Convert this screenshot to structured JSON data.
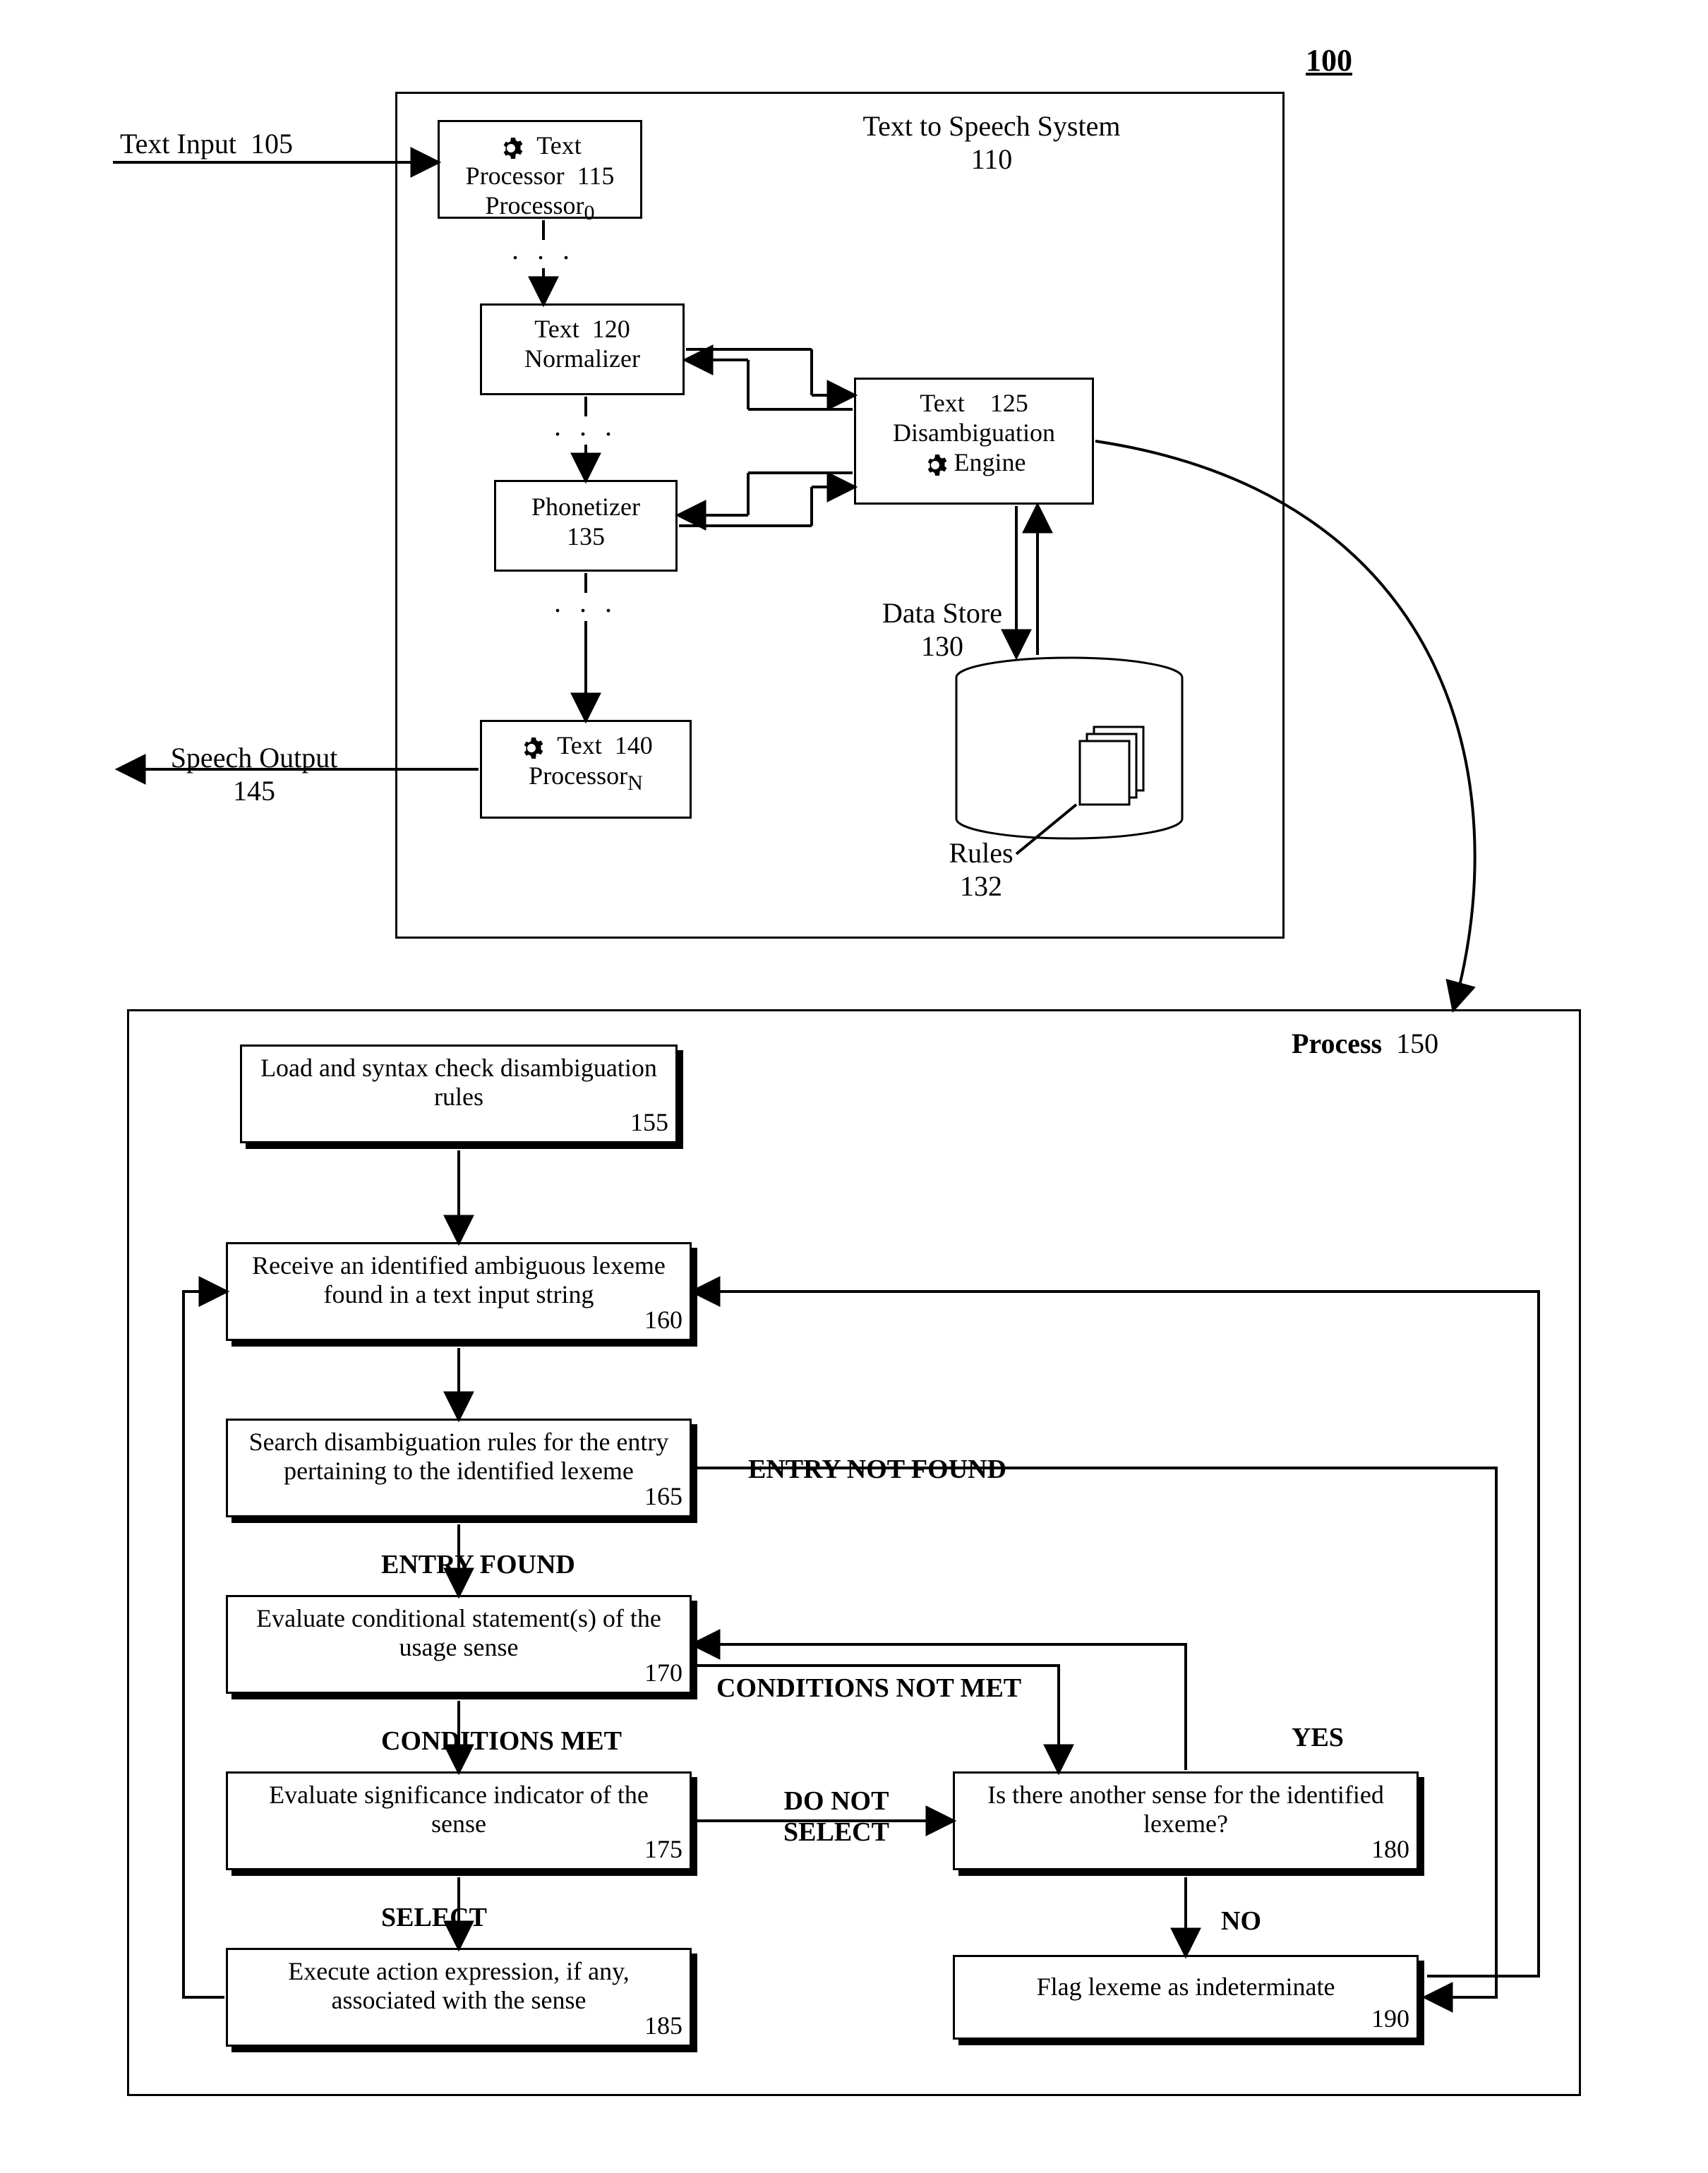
{
  "fig_ref": "100",
  "text_input_label": "Text Input",
  "text_input_ref": "105",
  "speech_output_label": "Speech Output",
  "speech_output_ref": "145",
  "sys_panel_label": "Text to Speech System",
  "sys_panel_ref": "110",
  "box115": {
    "label": "Text Processor",
    "sub": "0",
    "ref": "115"
  },
  "box120": {
    "label": "Text Normalizer",
    "ref": "120"
  },
  "box135": {
    "label": "Phonetizer",
    "ref": "135"
  },
  "box140": {
    "label": "Text Processor",
    "sub": "N",
    "ref": "140"
  },
  "box125": {
    "label": "Text Disambiguation Engine",
    "label_l1": "Text",
    "label_l2": "Disambiguation",
    "label_l3": "Engine",
    "ref": "125"
  },
  "data_store_label": "Data Store",
  "data_store_ref": "130",
  "rules_label": "Rules",
  "rules_ref": "132",
  "process_label": "Process",
  "process_ref": "150",
  "step155": {
    "text": "Load and syntax check disambiguation rules",
    "ref": "155"
  },
  "step160": {
    "text": "Receive an identified ambiguous lexeme found in a text input string",
    "ref": "160"
  },
  "step165": {
    "text": "Search disambiguation rules for the entry pertaining to the identified lexeme",
    "ref": "165"
  },
  "step170": {
    "text": "Evaluate conditional statement(s) of the usage sense",
    "ref": "170"
  },
  "step175": {
    "text": "Evaluate significance indicator of the sense",
    "ref": "175"
  },
  "step185": {
    "text": "Execute action expression, if any, associated with the sense",
    "ref": "185"
  },
  "step180": {
    "text": "Is there another sense for the identified lexeme?",
    "ref": "180"
  },
  "step190": {
    "text": "Flag lexeme as indeterminate",
    "ref": "190"
  },
  "lbl_entry_found": "ENTRY FOUND",
  "lbl_entry_not_found": "ENTRY NOT FOUND",
  "lbl_conditions_met": "CONDITIONS MET",
  "lbl_conditions_not_met": "CONDITIONS NOT MET",
  "lbl_select": "SELECT",
  "lbl_do_not_select": "DO NOT SELECT",
  "lbl_yes": "YES",
  "lbl_no": "NO",
  "chart_data": {
    "type": "diagram",
    "title": "Text to Speech System and Disambiguation Process",
    "fig_ref": "100",
    "system_100": {
      "title": "Text to Speech System",
      "ref": "110",
      "input": {
        "label": "Text Input",
        "ref": "105"
      },
      "output": {
        "label": "Speech Output",
        "ref": "145"
      },
      "components": [
        {
          "ref": "115",
          "label": "Text Processor_0",
          "icon": "gear"
        },
        {
          "ref": "120",
          "label": "Text Normalizer"
        },
        {
          "ref": "135",
          "label": "Phonetizer"
        },
        {
          "ref": "140",
          "label": "Text Processor_N",
          "icon": "gear"
        },
        {
          "ref": "125",
          "label": "Text Disambiguation Engine",
          "icon": "gear"
        },
        {
          "ref": "130",
          "label": "Data Store",
          "shape": "cylinder",
          "contains": {
            "ref": "132",
            "label": "Rules",
            "icon": "documents"
          }
        }
      ],
      "edges": [
        {
          "from": "105",
          "to": "115"
        },
        {
          "from": "115",
          "to": "120",
          "style": "ellipsis"
        },
        {
          "from": "120",
          "to": "135",
          "style": "ellipsis"
        },
        {
          "from": "135",
          "to": "140",
          "style": "ellipsis"
        },
        {
          "from": "140",
          "to": "145"
        },
        {
          "from": "120",
          "to": "125",
          "bidir": true
        },
        {
          "from": "135",
          "to": "125",
          "bidir": true
        },
        {
          "from": "125",
          "to": "130",
          "bidir": true
        },
        {
          "from": "125",
          "to": "process_150",
          "style": "curved"
        }
      ]
    },
    "process_150": {
      "title": "Process",
      "ref": "150",
      "steps": [
        {
          "ref": "155",
          "text": "Load and syntax check disambiguation rules"
        },
        {
          "ref": "160",
          "text": "Receive an identified ambiguous lexeme found in a text input string"
        },
        {
          "ref": "165",
          "text": "Search disambiguation rules for the entry pertaining to the identified lexeme"
        },
        {
          "ref": "170",
          "text": "Evaluate conditional statement(s) of the usage sense"
        },
        {
          "ref": "175",
          "text": "Evaluate significance indicator of the sense"
        },
        {
          "ref": "185",
          "text": "Execute action expression, if any, associated with the sense"
        },
        {
          "ref": "180",
          "text": "Is there another sense for the identified lexeme?"
        },
        {
          "ref": "190",
          "text": "Flag lexeme as indeterminate"
        }
      ],
      "edges": [
        {
          "from": "155",
          "to": "160"
        },
        {
          "from": "160",
          "to": "165"
        },
        {
          "from": "165",
          "to": "170",
          "label": "ENTRY FOUND"
        },
        {
          "from": "165",
          "to": "190",
          "label": "ENTRY NOT FOUND"
        },
        {
          "from": "170",
          "to": "175",
          "label": "CONDITIONS MET"
        },
        {
          "from": "170",
          "to": "180",
          "label": "CONDITIONS NOT MET"
        },
        {
          "from": "175",
          "to": "185",
          "label": "SELECT"
        },
        {
          "from": "175",
          "to": "180",
          "label": "DO NOT SELECT"
        },
        {
          "from": "180",
          "to": "170",
          "label": "YES"
        },
        {
          "from": "180",
          "to": "190",
          "label": "NO"
        },
        {
          "from": "185",
          "to": "160",
          "style": "loop"
        },
        {
          "from": "190",
          "to": "160",
          "style": "loop"
        }
      ]
    }
  }
}
